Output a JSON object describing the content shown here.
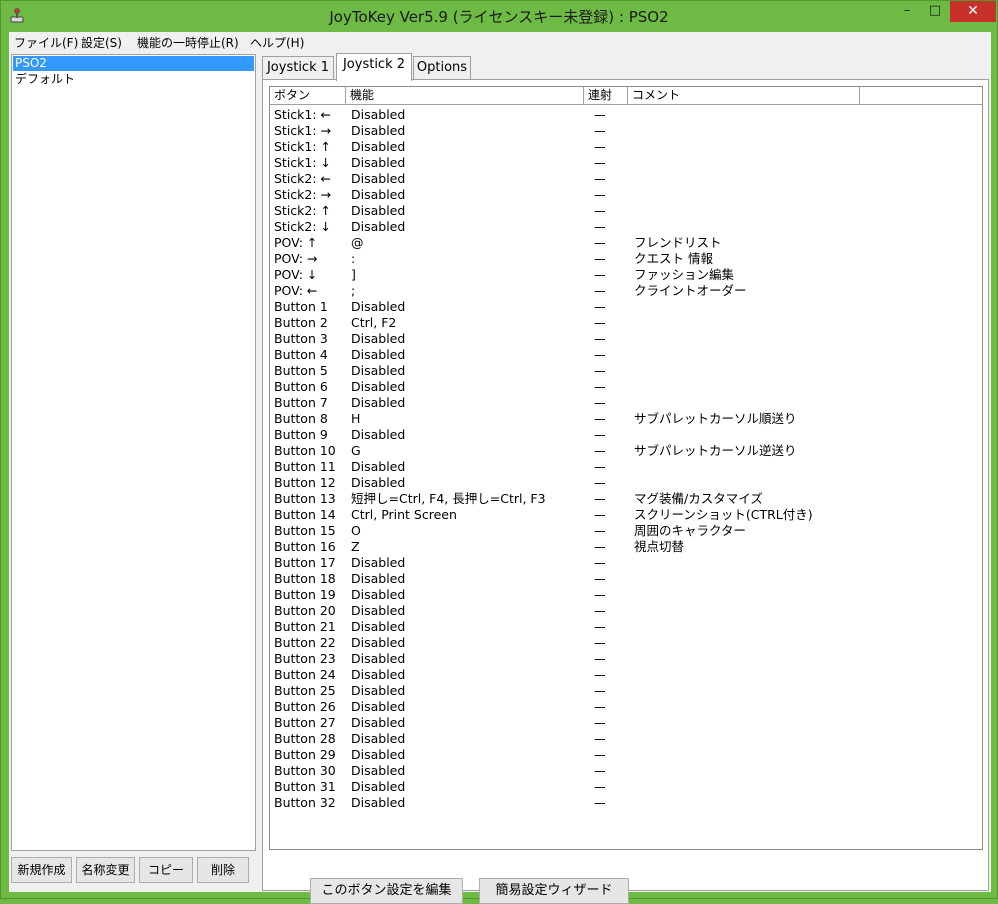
{
  "window": {
    "title": "JoyToKey Ver5.9 (ライセンスキー未登録) : PSO2",
    "min_label": "–",
    "max_label": "□",
    "close_label": "✕"
  },
  "menu": [
    "ファイル(F)",
    "設定(S)",
    "機能の一時停止(R)",
    "ヘルプ(H)"
  ],
  "profiles": [
    "PSO2",
    "デフォルト"
  ],
  "profile_buttons": {
    "new": "新規作成",
    "rename": "名称変更",
    "copy": "コピー",
    "delete": "削除"
  },
  "tabs": [
    "Joystick 1",
    "Joystick 2",
    "Options"
  ],
  "active_tab": 1,
  "columns": [
    "ボタン",
    "機能",
    "連射",
    "コメント"
  ],
  "rows": [
    [
      "Stick1: ←",
      "Disabled",
      "---",
      ""
    ],
    [
      "Stick1: →",
      "Disabled",
      "---",
      ""
    ],
    [
      "Stick1: ↑",
      "Disabled",
      "---",
      ""
    ],
    [
      "Stick1: ↓",
      "Disabled",
      "---",
      ""
    ],
    [
      "Stick2: ←",
      "Disabled",
      "---",
      ""
    ],
    [
      "Stick2: →",
      "Disabled",
      "---",
      ""
    ],
    [
      "Stick2: ↑",
      "Disabled",
      "---",
      ""
    ],
    [
      "Stick2: ↓",
      "Disabled",
      "---",
      ""
    ],
    [
      "POV: ↑",
      "@",
      "---",
      "フレンドリスト"
    ],
    [
      "POV: →",
      ":",
      "---",
      "クエスト 情報"
    ],
    [
      "POV: ↓",
      "]",
      "---",
      "ファッション編集"
    ],
    [
      "POV: ←",
      ";",
      "---",
      "クライントオーダー"
    ],
    [
      "Button 1",
      "Disabled",
      "---",
      ""
    ],
    [
      "Button 2",
      "Ctrl, F2",
      "---",
      ""
    ],
    [
      "Button 3",
      "Disabled",
      "---",
      ""
    ],
    [
      "Button 4",
      "Disabled",
      "---",
      ""
    ],
    [
      "Button 5",
      "Disabled",
      "---",
      ""
    ],
    [
      "Button 6",
      "Disabled",
      "---",
      ""
    ],
    [
      "Button 7",
      "Disabled",
      "---",
      ""
    ],
    [
      "Button 8",
      "H",
      "---",
      "サブパレットカーソル順送り"
    ],
    [
      "Button 9",
      "Disabled",
      "---",
      ""
    ],
    [
      "Button 10",
      "G",
      "---",
      "サブパレットカーソル逆送り"
    ],
    [
      "Button 11",
      "Disabled",
      "---",
      ""
    ],
    [
      "Button 12",
      "Disabled",
      "---",
      ""
    ],
    [
      "Button 13",
      "短押し=Ctrl, F4, 長押し=Ctrl, F3",
      "---",
      "マグ装備/カスタマイズ"
    ],
    [
      "Button 14",
      "Ctrl, Print Screen",
      "---",
      "スクリーンショット(CTRL付き)"
    ],
    [
      "Button 15",
      "O",
      "---",
      "周囲のキャラクター"
    ],
    [
      "Button 16",
      "Z",
      "---",
      "視点切替"
    ],
    [
      "Button 17",
      "Disabled",
      "---",
      ""
    ],
    [
      "Button 18",
      "Disabled",
      "---",
      ""
    ],
    [
      "Button 19",
      "Disabled",
      "---",
      ""
    ],
    [
      "Button 20",
      "Disabled",
      "---",
      ""
    ],
    [
      "Button 21",
      "Disabled",
      "---",
      ""
    ],
    [
      "Button 22",
      "Disabled",
      "---",
      ""
    ],
    [
      "Button 23",
      "Disabled",
      "---",
      ""
    ],
    [
      "Button 24",
      "Disabled",
      "---",
      ""
    ],
    [
      "Button 25",
      "Disabled",
      "---",
      ""
    ],
    [
      "Button 26",
      "Disabled",
      "---",
      ""
    ],
    [
      "Button 27",
      "Disabled",
      "---",
      ""
    ],
    [
      "Button 28",
      "Disabled",
      "---",
      ""
    ],
    [
      "Button 29",
      "Disabled",
      "---",
      ""
    ],
    [
      "Button 30",
      "Disabled",
      "---",
      ""
    ],
    [
      "Button 31",
      "Disabled",
      "---",
      ""
    ],
    [
      "Button 32",
      "Disabled",
      "---",
      ""
    ]
  ],
  "bottom_buttons": {
    "edit": "このボタン設定を編集",
    "wizard": "簡易設定ウィザード"
  },
  "colors": {
    "frame": "#6dbb45",
    "selection": "#3399ff",
    "close": "#c7312a"
  }
}
